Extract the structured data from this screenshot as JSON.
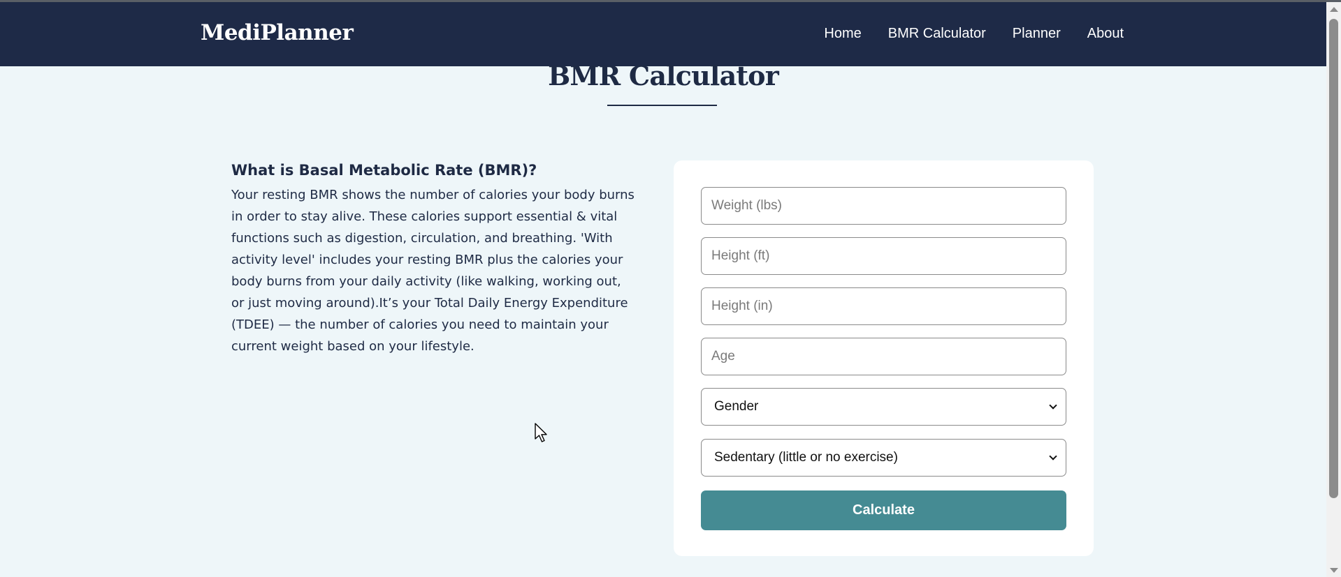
{
  "navbar": {
    "brand": "MediPlanner",
    "links": [
      "Home",
      "BMR Calculator",
      "Planner",
      "About"
    ]
  },
  "page": {
    "title": "BMR Calculator"
  },
  "info": {
    "heading": "What is Basal Metabolic Rate (BMR)?",
    "body": "Your resting BMR shows the number of calories your body burns in order to stay alive. These calories support essential & vital functions such as digestion, circulation, and breathing. 'With activity level' includes your resting BMR plus the calories your body burns from your daily activity (like walking, working out, or just moving around).It’s your Total Daily Energy Expenditure (TDEE) — the number of calories you need to maintain your current weight based on your lifestyle."
  },
  "form": {
    "weight_placeholder": "Weight (lbs)",
    "height_ft_placeholder": "Height (ft)",
    "height_in_placeholder": "Height (in)",
    "age_placeholder": "Age",
    "gender_selected": "Gender",
    "activity_selected": "Sedentary (little or no exercise)",
    "submit_label": "Calculate"
  },
  "colors": {
    "navbar_bg": "#1e2a47",
    "page_bg": "#eef6f9",
    "button_bg": "#458b93",
    "text_dark": "#1e2a44"
  }
}
